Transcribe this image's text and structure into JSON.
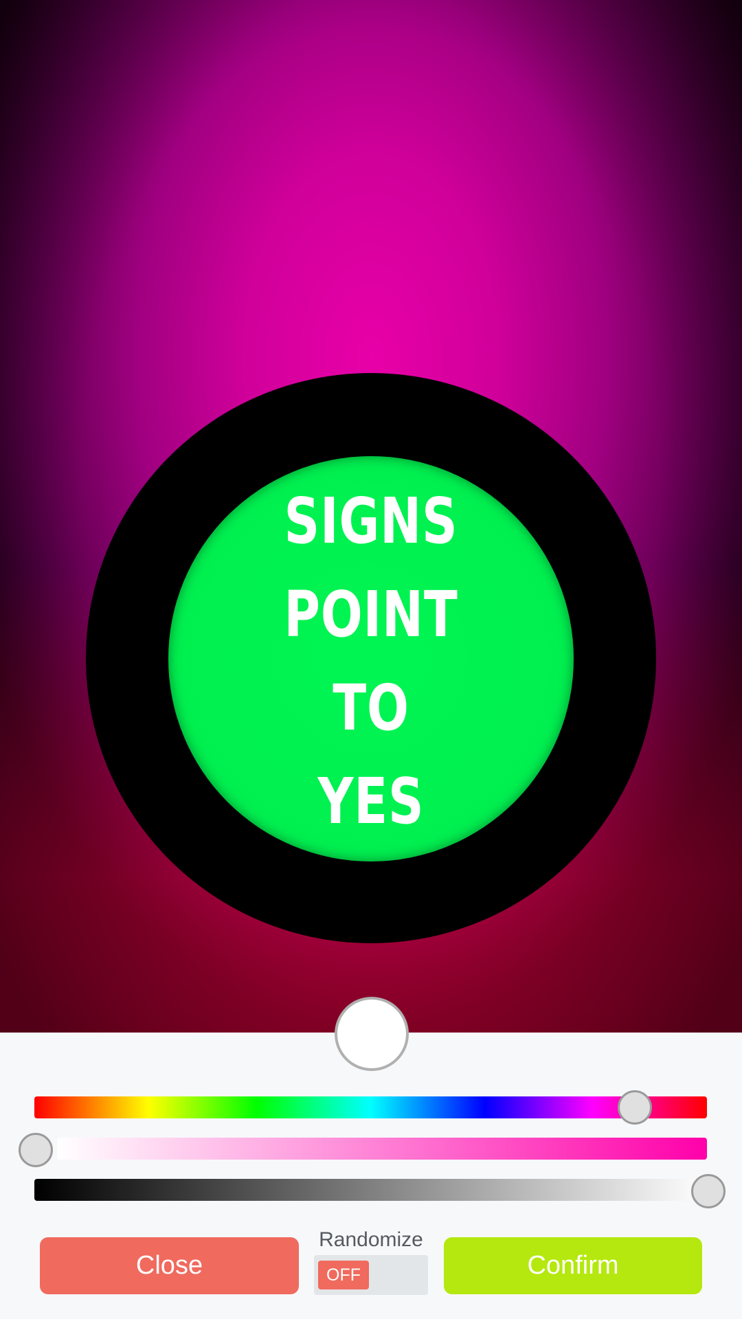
{
  "magic_ball": {
    "answer_lines": [
      "SIGNS",
      "POINT TO",
      "YES"
    ],
    "window_color": "#00f050",
    "background_colors": [
      "#e800a8",
      "#e6003c"
    ]
  },
  "color_picker": {
    "selected_color": "#ffffff",
    "hue_gradient": "rainbow",
    "saturation_gradient": [
      "#ffffff",
      "#ff00aa"
    ],
    "value_gradient": [
      "#000000",
      "#ffffff"
    ]
  },
  "buttons": {
    "close_label": "Close",
    "confirm_label": "Confirm",
    "close_color": "#f06a5e",
    "confirm_color": "#b4e80e"
  },
  "randomize": {
    "label": "Randomize",
    "state_label": "OFF"
  }
}
